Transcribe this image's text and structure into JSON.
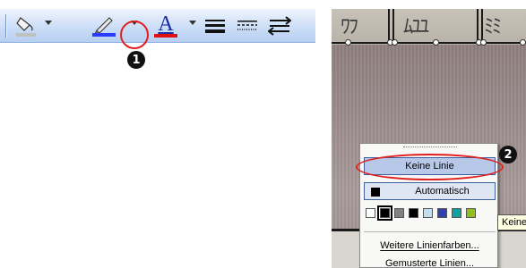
{
  "toolbar": {
    "step_badge_1": "1",
    "fill_color": "#c0c0c0",
    "line_color": "#2a3cff",
    "font_color": "#e01010",
    "font_glyph": "A",
    "icons": [
      "fill-color-icon",
      "line-color-icon",
      "font-color-icon",
      "line-style-icon",
      "dash-style-icon",
      "arrow-style-icon"
    ]
  },
  "dropdown": {
    "step_badge_2": "2",
    "no_line_label": "Keine Linie",
    "automatic_label": "Automatisch",
    "swatch_colors": [
      "#ffffff",
      "#000000",
      "#808080",
      "#000000",
      "#c0e0f0",
      "#3040b0",
      "#10a0a0",
      "#90c020"
    ],
    "selected_swatch_index": 1,
    "more_colors_label": "Weitere Linienfarben...",
    "more_colors_accel": "W",
    "patterned_lines_label": "Gemusterte Linien...",
    "patterned_lines_accel": "u",
    "tooltip": "Keine L"
  },
  "colors": {
    "highlight_red": "#e02020",
    "menu_highlight": "#b7c8e8",
    "menu_border": "#3d5f9d"
  }
}
